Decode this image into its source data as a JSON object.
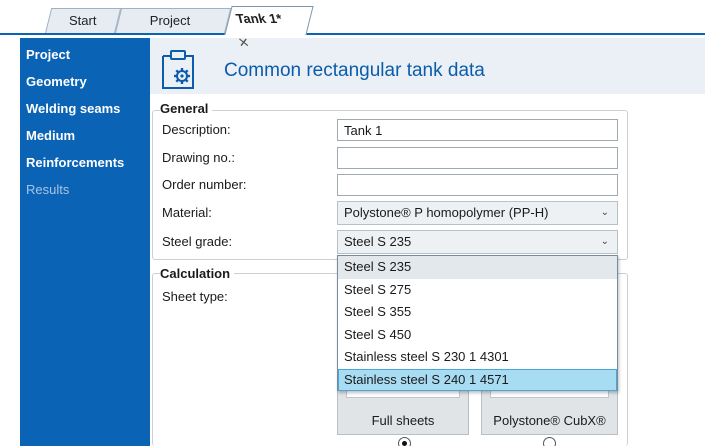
{
  "tabs": [
    {
      "label": "Start"
    },
    {
      "label": "Project manager"
    },
    {
      "label": "Tank 1*",
      "close": "✕"
    }
  ],
  "sidebar": {
    "items": [
      {
        "label": "Project"
      },
      {
        "label": "Geometry"
      },
      {
        "label": "Welding seams"
      },
      {
        "label": "Medium"
      },
      {
        "label": "Reinforcements"
      },
      {
        "label": "Results"
      }
    ]
  },
  "header": {
    "title": "Common rectangular tank data",
    "icon": "clipboard-gear-icon"
  },
  "general": {
    "title": "General",
    "description_label": "Description:",
    "description_value": "Tank 1",
    "drawing_label": "Drawing no.:",
    "drawing_value": "",
    "order_label": "Order number:",
    "order_value": "",
    "material_label": "Material:",
    "material_value": "Polystone® P homopolymer (PP-H)",
    "steel_label": "Steel grade:",
    "steel_value": "Steel S 235"
  },
  "steel_options": [
    "Steel S 235",
    "Steel S 275",
    "Steel S 355",
    "Steel S 450",
    "Stainless steel S 230 1 4301",
    "Stainless steel S 240 1 4571"
  ],
  "calculation": {
    "title": "Calculation",
    "sheet_type_label": "Sheet type:",
    "options": [
      {
        "label": "Full sheets",
        "selected": true
      },
      {
        "label": "Polystone® CubX®",
        "selected": false
      }
    ]
  },
  "colors": {
    "accent": "#0a63b5",
    "title": "#0b5cab",
    "selected_option": "#a8dcf3"
  }
}
